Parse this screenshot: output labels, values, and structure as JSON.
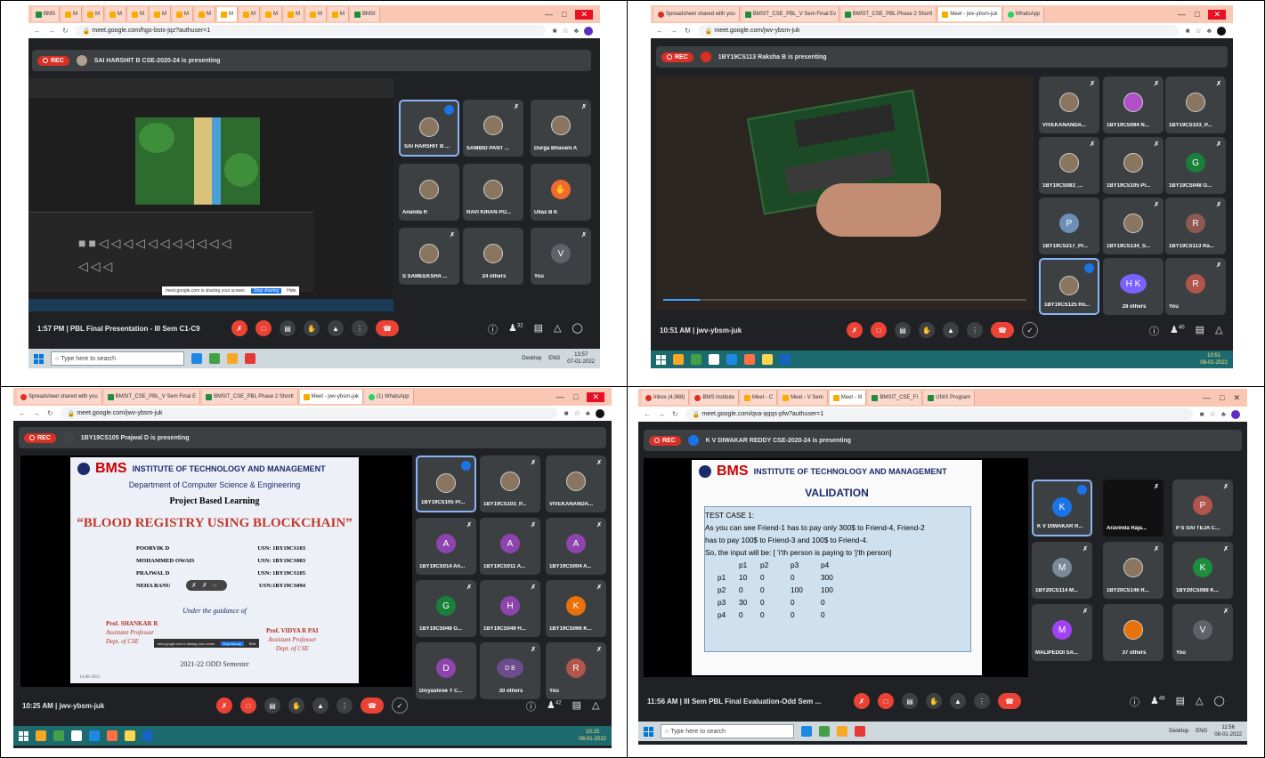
{
  "q1": {
    "tabs": [
      "BMS",
      "M",
      "M",
      "M",
      "M",
      "M",
      "M",
      "M",
      "M",
      "M",
      "M",
      "M",
      "M",
      "M",
      "BMSI"
    ],
    "url": "meet.google.com/hgo-bstx-jqz?authuser=1",
    "rec": "REC",
    "presenting": "SAI HARSHIT B CSE-2020-24 is presenting",
    "share_notice": "meet.google.com is sharing your screen.",
    "stop_sharing": "Stop sharing",
    "hide": "Hide",
    "tiles": [
      {
        "name": "SAI HARSHIT B ..."
      },
      {
        "name": "SAMBID PANT ..."
      },
      {
        "name": "Durga Bhavani A"
      },
      {
        "name": "Ananda R"
      },
      {
        "name": "RAVI KIRAN PO..."
      },
      {
        "name": "Ullas B K"
      },
      {
        "name": "S SAMEEKSHA ..."
      },
      {
        "name": "24 others"
      },
      {
        "name": "You",
        "initial": "V"
      }
    ],
    "meeting_time": "1:57 PM",
    "meeting_title": "PBL Final Presentation - III Sem C1-C9",
    "participants": "32",
    "taskbar_search": "Type here to search",
    "taskbar_desktop": "Desktop",
    "taskbar_lang": "ENG",
    "clock_time": "13:57",
    "clock_date": "07-01-2022"
  },
  "q2": {
    "tabs": [
      "Spreadsheet shared with you",
      "BMSIT_CSE_PBL_V Sem Final Ev",
      "BMSIT_CSE_PBL Phase 2 Shortl",
      "Meet - jwv-ybsm-juk",
      "WhatsApp"
    ],
    "url": "meet.google.com/jwv-ybsm-juk",
    "rec": "REC",
    "presenting": "1BY19CS113 Raksha B is presenting",
    "tiles": [
      {
        "name": "VIVEKANANDA..."
      },
      {
        "name": "1BY19CS094 N..."
      },
      {
        "name": "1BY19CS103_P..."
      },
      {
        "name": "1BY19CS083_..."
      },
      {
        "name": "1BY19CS105 Pr..."
      },
      {
        "name": "1BY19CS048 G...",
        "initial": "G"
      },
      {
        "name": "1BY19CS217_Pr...",
        "initial": "P"
      },
      {
        "name": "1BY19CS134_S..."
      },
      {
        "name": "1BY19CS113 Ra...",
        "initial": "R"
      },
      {
        "name": "1BY19CS125 Ro..."
      },
      {
        "name": "28 others"
      },
      {
        "name": "You",
        "initial": "R"
      }
    ],
    "meeting_time": "10:51 AM",
    "meeting_title": "jwv-ybsm-juk",
    "participants": "40",
    "clock_time": "10:51",
    "clock_date": "08-01-2022"
  },
  "q3": {
    "tabs": [
      "Spreadsheet shared with you",
      "BMSIT_CSE_PBL_V Sem Final E",
      "BMSIT_CSE_PBL Phase 2 Shortl",
      "Meet - jwv-ybsm-juk",
      "(1) WhatsApp"
    ],
    "url": "meet.google.com/jwv-ybsm-juk",
    "rec": "REC",
    "presenting": "1BY19CS105 Prajwal D is presenting",
    "slide": {
      "bms": "BMS",
      "inst": "INSTITUTE OF TECHNOLOGY AND MANAGEMENT",
      "dept": "Department of Computer Science & Engineering",
      "pbl": "Project Based Learning",
      "title": "“BLOOD REGISTRY USING BLOCKCHAIN”",
      "members": [
        {
          "name": "POORVIK D",
          "usn": "USN: 1BY19CS103"
        },
        {
          "name": "MOHAMMED OWAIS",
          "usn": "USN: 1BY19CS083"
        },
        {
          "name": "PRAJWAL D",
          "usn": "USN: 1BY19CS105"
        },
        {
          "name": "NEHA BANU",
          "usn": "USN:1BY19CS094"
        }
      ],
      "guidance": "Under the guidance of",
      "guide1": "Prof. SHANKAR R",
      "guide1_role": "Assistant Professor",
      "guide1_dept": "Dept. of CSE",
      "guide2": "Prof. VIDYA R PAI",
      "guide2_role": "Assistant Professor",
      "guide2_dept": "Dept. of CSE",
      "year": "2021-22 ODD Semester",
      "date": "14-08-2021"
    },
    "share_notice": "meet.google.com is sharing your screen.",
    "stop_sharing": "Stop sharing",
    "hide": "Hide",
    "tiles": [
      {
        "name": "1BY19CS105 Pr..."
      },
      {
        "name": "1BY19CS103_P..."
      },
      {
        "name": "VIVEKANANDA..."
      },
      {
        "name": "1BY19CS014 An...",
        "initial": "A"
      },
      {
        "name": "1BY19CS011 A...",
        "initial": "A"
      },
      {
        "name": "1BY19CS004 A...",
        "initial": "A"
      },
      {
        "name": "1BY19CS048 G...",
        "initial": "G"
      },
      {
        "name": "1BY19CS049 H...",
        "initial": "H"
      },
      {
        "name": "1BY19CS066 K...",
        "initial": "K"
      },
      {
        "name": "Divyashree Y C...",
        "initial": "D"
      },
      {
        "name": "30 others"
      },
      {
        "name": "You",
        "initial": "R"
      }
    ],
    "meeting_time": "10:25 AM",
    "meeting_title": "jwv-ybsm-juk",
    "participants": "42",
    "clock_time": "10:25",
    "clock_date": "08-01-2022"
  },
  "q4": {
    "tabs": [
      "Inbox (4,968)",
      "BMS Institute",
      "Meet - C",
      "Meet - V Sem",
      "Meet - III",
      "BMSIT_CSE_FI",
      "UNIX Program"
    ],
    "url": "meet.google.com/qva-qqqs-pfw?authuser=1",
    "rec": "REC",
    "presenting": "K V DIWAKAR REDDY CSE-2020-24 is presenting",
    "slide": {
      "bms": "BMS",
      "inst": "INSTITUTE OF TECHNOLOGY AND MANAGEMENT",
      "heading": "VALIDATION",
      "lines": [
        "TEST CASE 1:",
        "As you can see Friend-1 has to pay only 300$ to Friend-4, Friend-2",
        "has to pay 100$ to Friend-3 and 100$ to Friend-4.",
        "So, the input will be: [ 'i'th person is paying to 'j'th person]"
      ],
      "matrix_header": [
        "p1",
        "p2",
        "p3",
        "p4"
      ],
      "matrix": [
        [
          "p1",
          "10",
          "0",
          "0",
          "300"
        ],
        [
          "p2",
          "0",
          "0",
          "100",
          "100"
        ],
        [
          "p3",
          "30",
          "0",
          "0",
          "0"
        ],
        [
          "p4",
          "0",
          "0",
          "0",
          "0"
        ]
      ]
    },
    "tiles": [
      {
        "name": "K V DIWAKAR R...",
        "initial": "K"
      },
      {
        "name": "Aravinda Raja..."
      },
      {
        "name": "P S SAI TEJA C...",
        "initial": "P"
      },
      {
        "name": "1BY20CS114 M...",
        "initial": "M"
      },
      {
        "name": "1BY20CS146 R..."
      },
      {
        "name": "1BY20CS088 K...",
        "initial": "K"
      },
      {
        "name": "MALIPEDDI SA...",
        "initial": "M"
      },
      {
        "name": "37 others"
      },
      {
        "name": "You",
        "initial": "V"
      }
    ],
    "meeting_time": "11:56 AM",
    "meeting_title": "III Sem PBL Final Evaluation-Odd Sem ...",
    "participants": "46",
    "taskbar_search": "Type here to search",
    "taskbar_desktop": "Desktop",
    "taskbar_lang": "ENG",
    "clock_time": "11:56",
    "clock_date": "08-01-2022"
  }
}
